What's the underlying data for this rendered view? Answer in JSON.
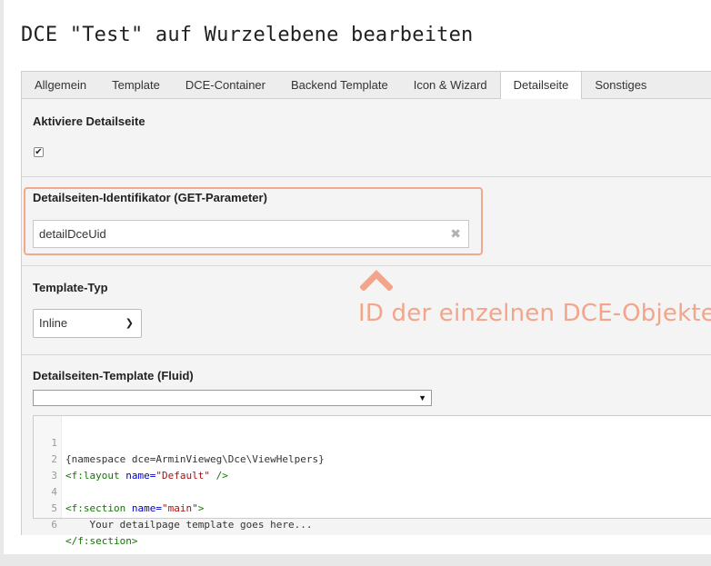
{
  "title": "DCE \"Test\" auf Wurzelebene bearbeiten",
  "tabs": [
    {
      "label": "Allgemein",
      "active": false
    },
    {
      "label": "Template",
      "active": false
    },
    {
      "label": "DCE-Container",
      "active": false
    },
    {
      "label": "Backend Template",
      "active": false
    },
    {
      "label": "Icon & Wizard",
      "active": false
    },
    {
      "label": "Detailseite",
      "active": true
    },
    {
      "label": "Sonstiges",
      "active": false
    }
  ],
  "fields": {
    "enable_detail": {
      "label": "Aktiviere Detailseite",
      "checked": true
    },
    "identifier": {
      "label": "Detailseiten-Identifikator (GET-Parameter)",
      "value": "detailDceUid"
    },
    "template_type": {
      "label": "Template-Typ",
      "value": "Inline"
    },
    "detail_template": {
      "label": "Detailseiten-Template (Fluid)",
      "select_value": ""
    }
  },
  "annotation": {
    "text": "ID der einzelnen DCE-Objekte",
    "color": "#f2a58a"
  },
  "code_lines": [
    {
      "n": "1",
      "text": "{namespace dce=ArminVieweg\\Dce\\ViewHelpers}"
    },
    {
      "n": "2",
      "text": "<f:layout name=\"Default\" />"
    },
    {
      "n": "3",
      "text": ""
    },
    {
      "n": "4",
      "text": "<f:section name=\"main\">"
    },
    {
      "n": "5",
      "text": "    Your detailpage template goes here..."
    },
    {
      "n": "6",
      "text": "</f:section>"
    }
  ],
  "code_segments": {
    "l1": "{namespace dce=ArminVieweg\\Dce\\ViewHelpers}",
    "l2_tag1": "<f:layout ",
    "l2_attr": "name=",
    "l2_str": "\"Default\"",
    "l2_tag2": " />",
    "l4_tag1": "<f:section ",
    "l4_attr": "name=",
    "l4_str": "\"main\"",
    "l4_tag2": ">",
    "l5": "    Your detailpage template goes here...",
    "l6": "</f:section>"
  },
  "icons": {
    "clear": "close-icon",
    "checkmark": "checkmark-icon",
    "chevron": "chevron-down-icon"
  }
}
